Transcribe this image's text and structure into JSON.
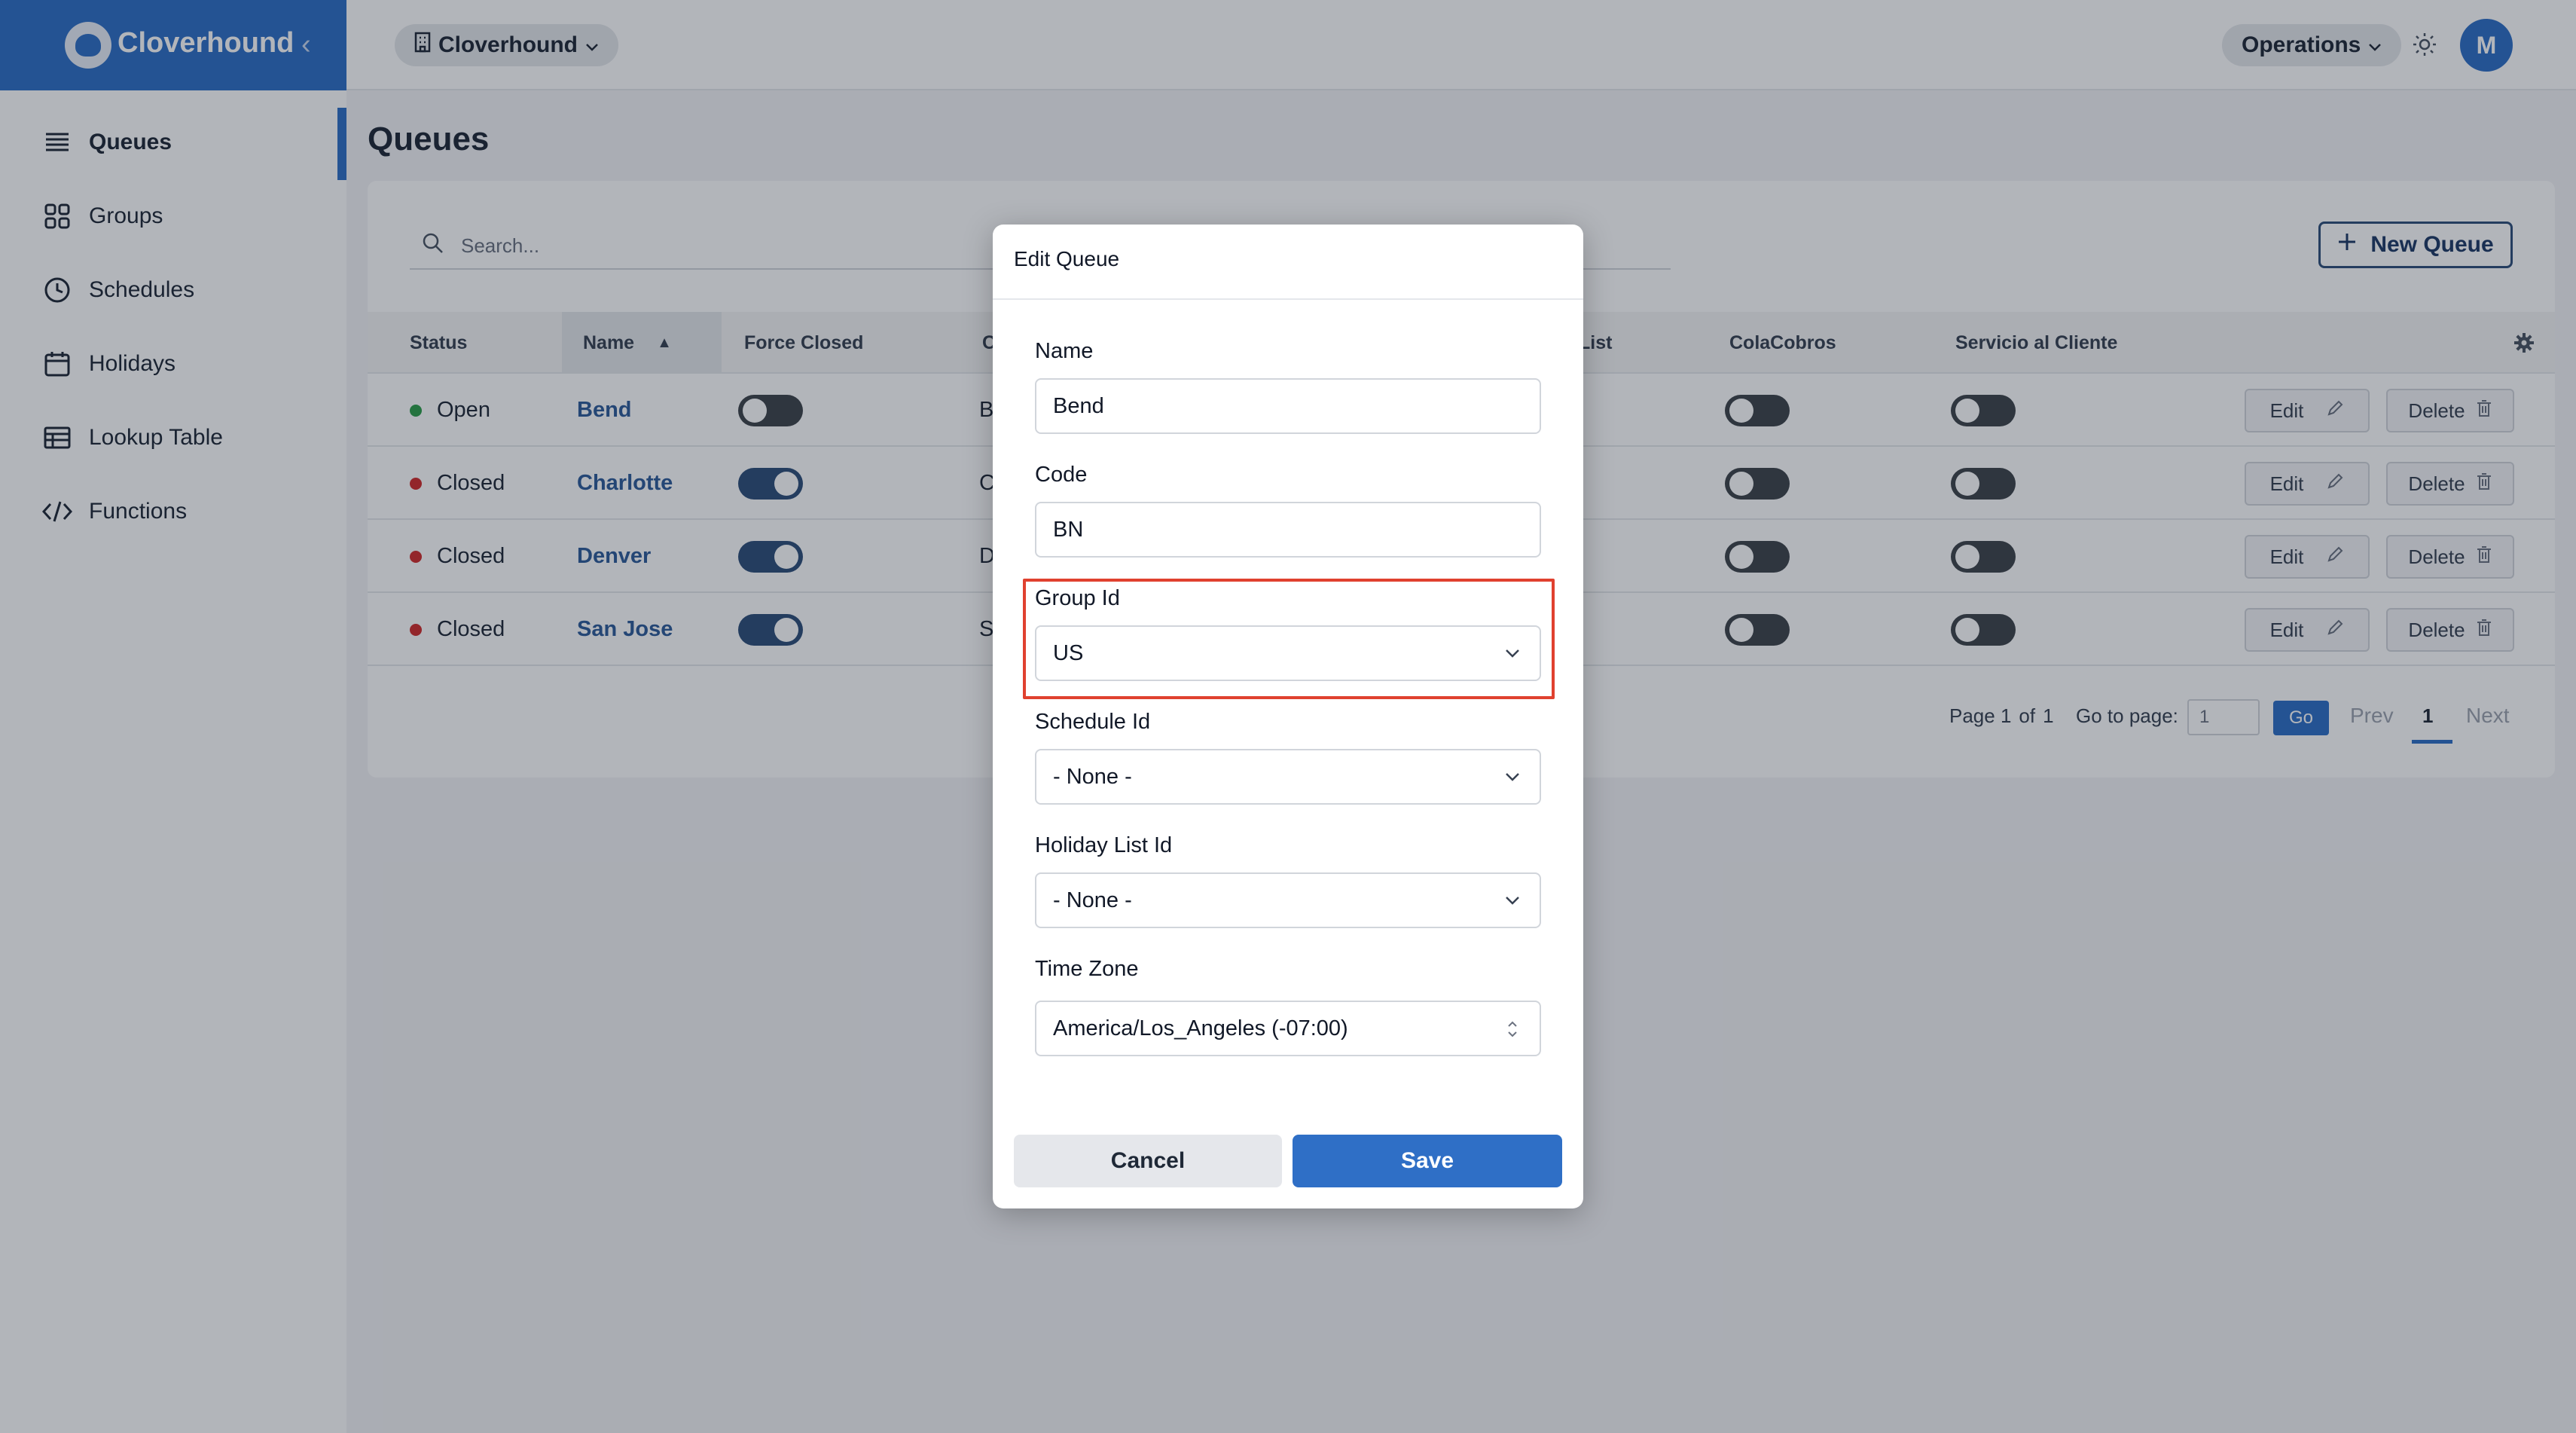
{
  "app": {
    "brand": "Cloverhound",
    "org_selector": "Cloverhound",
    "operations_menu": "Operations",
    "avatar_initial": "M",
    "accent_color": "#2f6fc6"
  },
  "sidebar": {
    "items": [
      {
        "label": "Queues",
        "icon": "queues-list-icon",
        "active": true
      },
      {
        "label": "Groups",
        "icon": "groups-grid-icon",
        "active": false
      },
      {
        "label": "Schedules",
        "icon": "clock-icon",
        "active": false
      },
      {
        "label": "Holidays",
        "icon": "calendar-icon",
        "active": false
      },
      {
        "label": "Lookup Table",
        "icon": "table-icon",
        "active": false
      },
      {
        "label": "Functions",
        "icon": "code-icon",
        "active": false
      }
    ]
  },
  "page": {
    "title": "Queues",
    "search_placeholder": "Search...",
    "new_queue_label": "New Queue"
  },
  "table": {
    "columns": [
      "Status",
      "Name",
      "Force Closed",
      "C",
      "List",
      "ColaCobros",
      "Servicio al Cliente"
    ],
    "sort_indicator": "▲",
    "rows": [
      {
        "status": "Open",
        "status_color": "#2e9e4a",
        "name": "Bend",
        "code_initial": "B",
        "force_closed": false,
        "cola_cobros": false,
        "servicio": false
      },
      {
        "status": "Closed",
        "status_color": "#d12d2d",
        "name": "Charlotte",
        "code_initial": "C",
        "force_closed": true,
        "cola_cobros": false,
        "servicio": false
      },
      {
        "status": "Closed",
        "status_color": "#d12d2d",
        "name": "Denver",
        "code_initial": "D",
        "force_closed": true,
        "cola_cobros": false,
        "servicio": false
      },
      {
        "status": "Closed",
        "status_color": "#d12d2d",
        "name": "San Jose",
        "code_initial": "S",
        "force_closed": true,
        "cola_cobros": false,
        "servicio": false
      }
    ],
    "edit_label": "Edit",
    "delete_label": "Delete"
  },
  "pagination": {
    "page_label": "Page 1",
    "of_label": "of",
    "total_pages": "1",
    "goto_label": "Go to page:",
    "goto_value": "1",
    "go_label": "Go",
    "prev_label": "Prev",
    "current_page": "1",
    "next_label": "Next"
  },
  "modal": {
    "title": "Edit Queue",
    "fields": {
      "name": {
        "label": "Name",
        "value": "Bend"
      },
      "code": {
        "label": "Code",
        "value": "BN"
      },
      "group_id": {
        "label": "Group Id",
        "value": "US"
      },
      "schedule_id": {
        "label": "Schedule Id",
        "value": "- None -"
      },
      "holiday_list_id": {
        "label": "Holiday List Id",
        "value": "- None -"
      },
      "time_zone": {
        "label": "Time Zone",
        "value": "America/Los_Angeles (-07:00)"
      }
    },
    "cancel_label": "Cancel",
    "save_label": "Save",
    "highlight_color": "#e0412f"
  }
}
